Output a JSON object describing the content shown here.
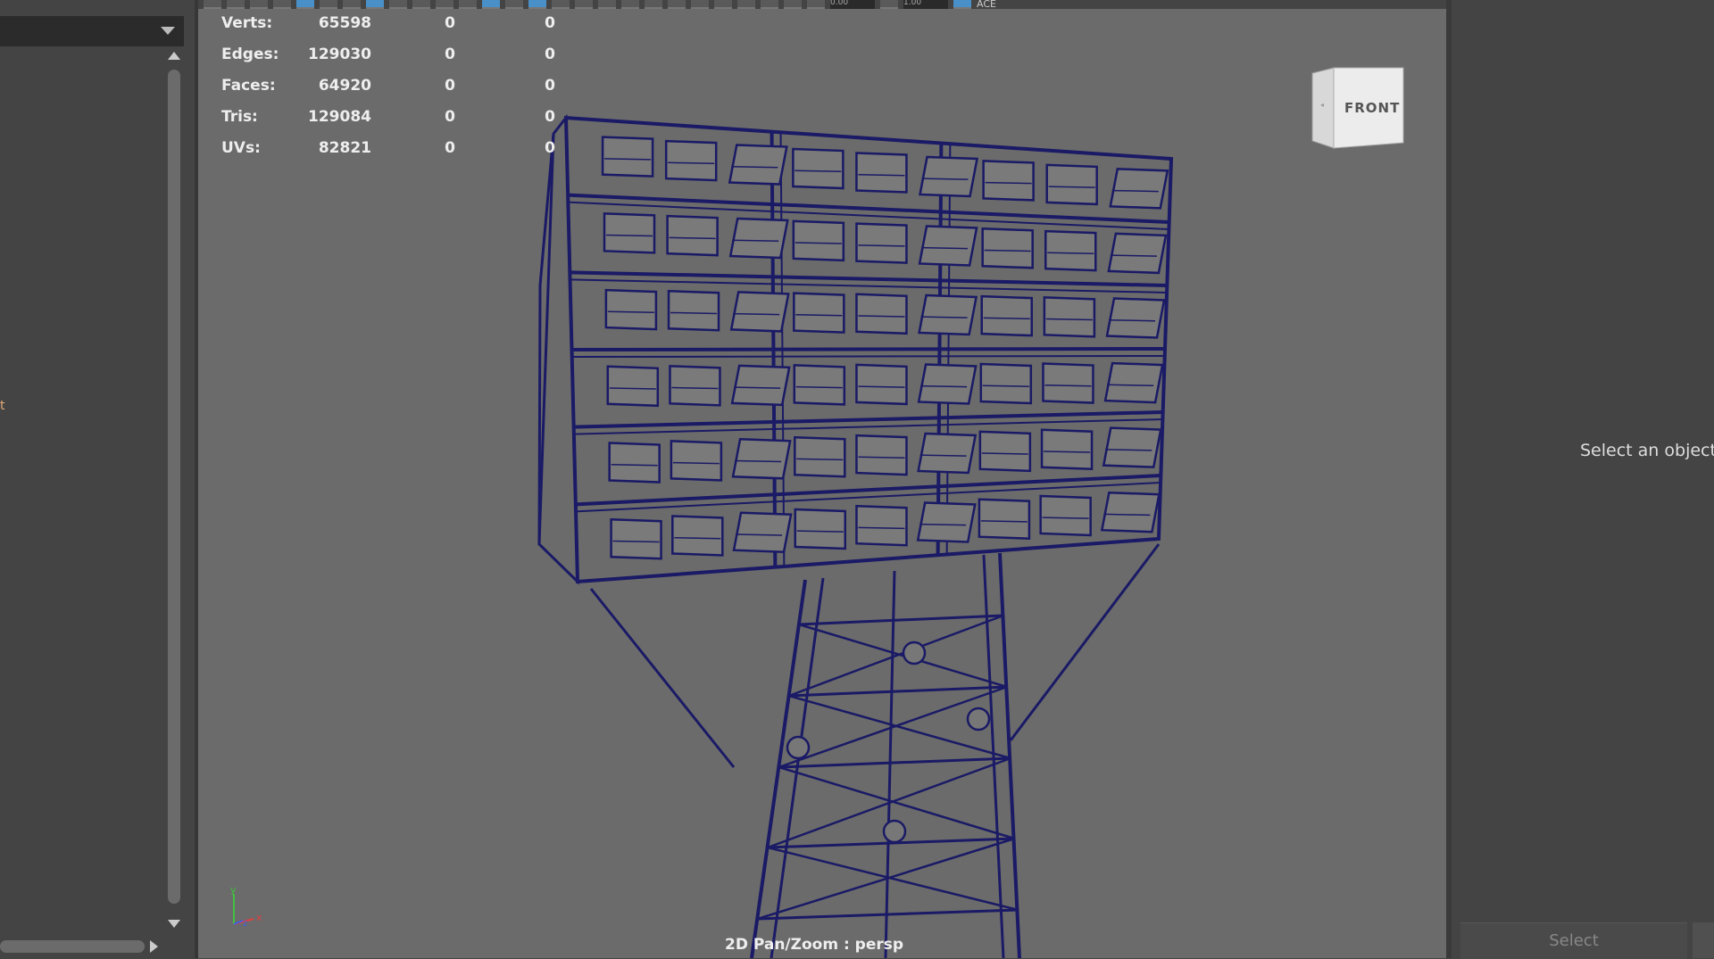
{
  "hud": {
    "rows": [
      {
        "label": "Verts:",
        "total": "65598",
        "sel1": "0",
        "sel2": "0"
      },
      {
        "label": "Edges:",
        "total": "129030",
        "sel1": "0",
        "sel2": "0"
      },
      {
        "label": "Faces:",
        "total": "64920",
        "sel1": "0",
        "sel2": "0"
      },
      {
        "label": "Tris:",
        "total": "129084",
        "sel1": "0",
        "sel2": "0"
      },
      {
        "label": "UVs:",
        "total": "82821",
        "sel1": "0",
        "sel2": "0"
      }
    ]
  },
  "toolbar": {
    "field1": "0.00",
    "field2": "1.00",
    "color_space": "ACE"
  },
  "view_cube": {
    "face": "FRONT"
  },
  "axis": {
    "x": "x",
    "y": "y",
    "z": "z"
  },
  "viewport": {
    "camera_label": "2D Pan/Zoom : persp"
  },
  "left_panel": {
    "mark": "t"
  },
  "attribute_editor": {
    "message": "Select an object i",
    "select_label": "Select"
  },
  "colors": {
    "wireframe": "#1a1a66",
    "viewport_bg": "#6b6b6b",
    "panel_bg": "#444444",
    "axis_x": "#e04040",
    "axis_y": "#40c040",
    "axis_z": "#4060e0"
  }
}
